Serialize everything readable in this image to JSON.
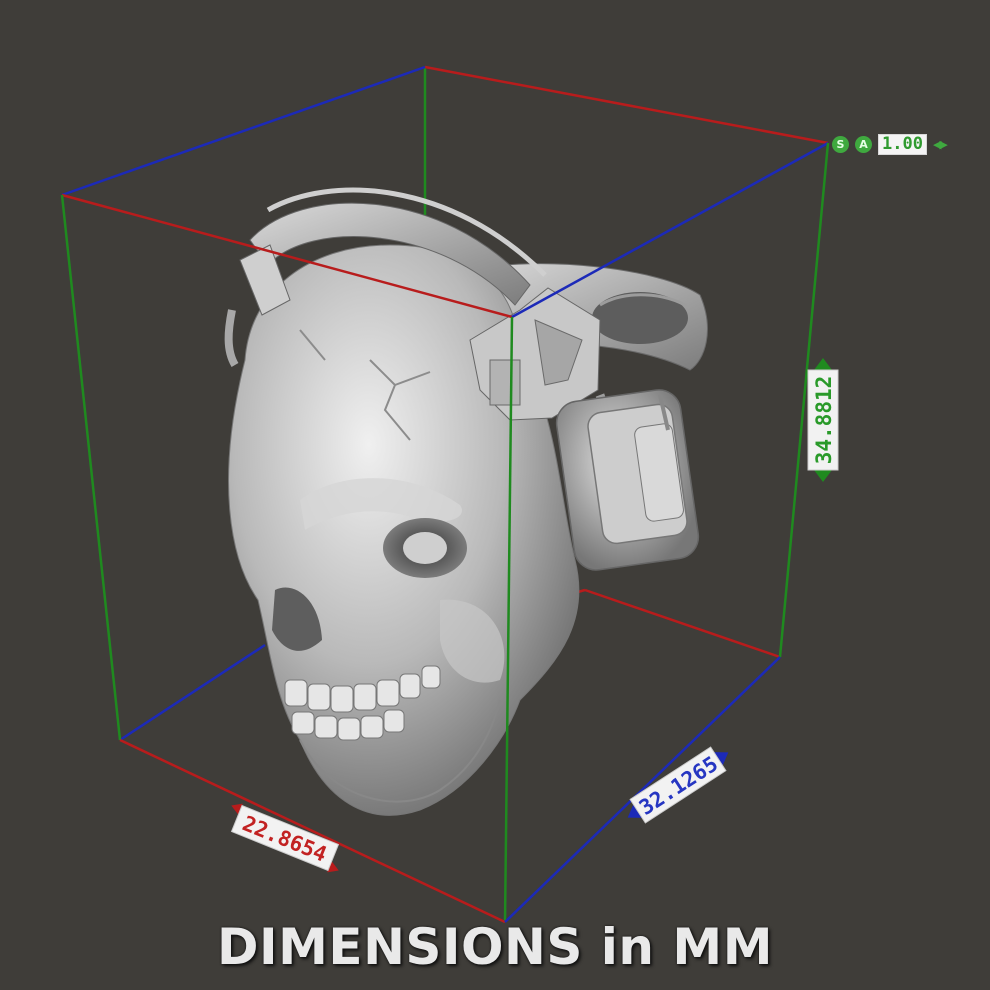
{
  "caption": "DIMENSIONS in MM",
  "dimensions": {
    "x_label": "22.8654",
    "y_label": "32.1265",
    "z_label": "34.8812"
  },
  "scale_widget": {
    "s_icon": "S",
    "a_icon": "A",
    "value": "1.00"
  },
  "colors": {
    "background": "#3f3d39",
    "x_axis": "#b81c1c",
    "y_axis": "#1c2ab8",
    "z_axis": "#1f8a1f",
    "model": "#b9b9b9"
  }
}
